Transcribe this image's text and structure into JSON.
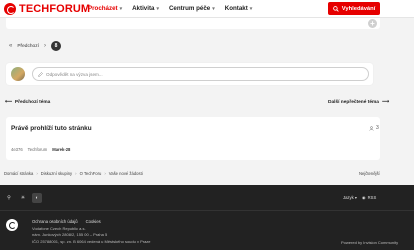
{
  "header": {
    "brand": "TECHFORUM",
    "nav": [
      {
        "label": "Procházet",
        "active": true
      },
      {
        "label": "Aktivita",
        "active": false
      },
      {
        "label": "Centrum péče",
        "active": false
      },
      {
        "label": "Kontakt",
        "active": false
      }
    ],
    "search_label": "Vyhledávání",
    "accent": "#e60000"
  },
  "pagination": {
    "prev_label": "Předchozí",
    "page": "8"
  },
  "reply": {
    "placeholder": "Odpovědět na výzva jsem...",
    "icon": "edit-icon"
  },
  "topic_nav": {
    "prev": "Předchozí téma",
    "next": "Další nepřečtené téma"
  },
  "viewing": {
    "title": "Právě prohlíží tuto stránku",
    "count": "3",
    "users": [
      "4e376",
      "Techforum",
      "Marek-28"
    ]
  },
  "breadcrumb": {
    "items": [
      "Domácí stránka",
      "Diskuzní skupiny",
      "O TechForu",
      "Vaše nové žádosti"
    ],
    "help": "Nejčtenější"
  },
  "footer": {
    "language": "Jazyk",
    "rss": "RSS",
    "links": [
      "Ochrana osobních údajů",
      "Cookies"
    ],
    "address": [
      "Vodafone Czech Republic a.s.",
      "nám. Junkových 2808/2, 155 00 – Praha 5",
      "IČO 25788001, sp. zn. B 6064 vedená u Městského soudu v Praze"
    ],
    "powered": "Powered by Invision Community"
  }
}
